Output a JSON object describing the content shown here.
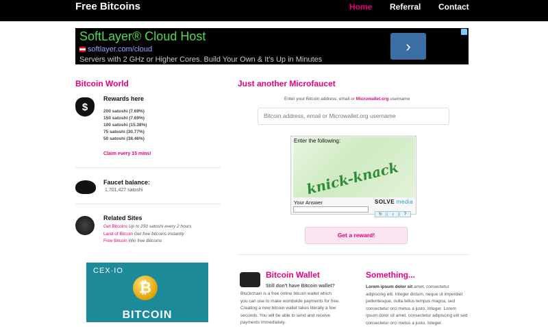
{
  "header": {
    "brand": "Free Bitcoins",
    "nav": [
      {
        "label": "Home",
        "active": true
      },
      {
        "label": "Referral",
        "active": false
      },
      {
        "label": "Contact",
        "active": false
      }
    ]
  },
  "ad": {
    "title": "SoftLayer® Cloud Host",
    "url": "softlayer.com/cloud",
    "description": "Servers with 2 GHz or Higher Cores. Build Your Own & It's Up in Minutes"
  },
  "sidebar": {
    "title": "Bitcoin World",
    "rewards": {
      "heading": "Rewards here",
      "items": [
        "200 satoshi (7.69%)",
        "150 satoshi (7.69%)",
        "100 satoshi (15.38%)",
        "75 satoshi (30.77%)",
        "50 satoshi (38.46%)"
      ],
      "claim": "Claim every 15 mins!"
    },
    "balance": {
      "heading": "Faucet balance:",
      "value": "1,701,427 satoshi"
    },
    "related": {
      "heading": "Related Sites",
      "items": [
        {
          "link": "Get Bitcoins",
          "text": "Up to 250 satoshi every 2 hours"
        },
        {
          "link": "Land of Bitcoin",
          "text": "Get free bitcoins instantly"
        },
        {
          "link": "Free Bitcoin",
          "text": "Win free Bitcoins"
        }
      ]
    },
    "banner": {
      "logo": "CEX·IO",
      "text": "BITCOIN"
    }
  },
  "main": {
    "title": "Just another Microfaucet",
    "instruction_prefix": "Enter your Bitcoin address, email or",
    "instruction_link": "Microwallet.org",
    "instruction_suffix": "username",
    "address_placeholder": "Bitcoin address, email or Microwallet.org username",
    "captcha": {
      "prompt": "Enter the following:",
      "word": "knick-knack",
      "answer_label": "Your Answer",
      "logo_solve": "SOLVE",
      "logo_media": "media"
    },
    "reward_button": "Get a reward!"
  },
  "wallet": {
    "title": "Bitcoin Wallet",
    "subtitle": "Still don't have Bitcoin wallet?",
    "text": "Blockchain is a free online bitcoin wallet which you can use to make worldwide payments for free. Creating a new bitcoin wallet takes literally a few seconds. You will be able to send and receive payments immediately."
  },
  "something": {
    "title": "Something...",
    "lead": "Lorem ipsum dolor sit",
    "text": "amet, consectetur adipiscing elit. Integer dictum, neque ut imperdiet pellentesque, nulla tellus tempus magna, sed consectetur orci metus a justo. Integer. Lorem ipsum dolor sit amet, consectetur adipiscing elit sed consectetur orci metus a justo. Integer."
  },
  "colors": {
    "accent": "#e6007e",
    "navbar": "#000000"
  }
}
